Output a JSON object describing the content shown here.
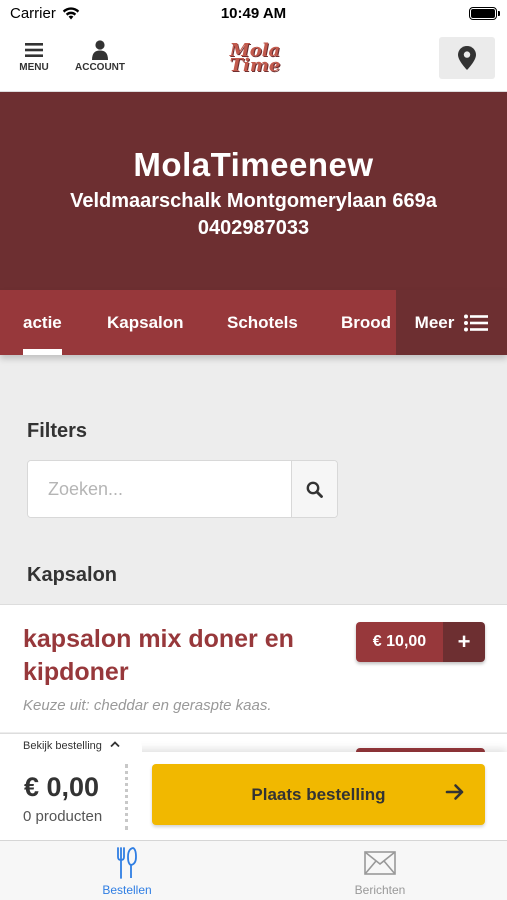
{
  "status_bar": {
    "carrier": "Carrier",
    "time": "10:49 AM"
  },
  "nav": {
    "menu_label": "MENU",
    "account_label": "ACCOUNT",
    "logo_line1": "Mola",
    "logo_line2": "Time"
  },
  "restaurant": {
    "name": "MolaTimeenew",
    "address": "Veldmaarschalk Montgomerylaan 669a",
    "phone": "0402987033"
  },
  "categories": {
    "items": [
      "actie",
      "Kapsalon",
      "Schotels",
      "Brood"
    ],
    "more_label": "Meer",
    "active_index": 0
  },
  "filters": {
    "title": "Filters",
    "search_placeholder": "Zoeken..."
  },
  "section": {
    "title": "Kapsalon"
  },
  "products": [
    {
      "name": "kapsalon mix doner en kipdoner",
      "description": "Keuze uit: cheddar en geraspte kaas.",
      "price": "€ 10,00",
      "add_label": "+"
    }
  ],
  "order": {
    "view_label": "Bekijk bestelling",
    "total": "€ 0,00",
    "count": "0 producten",
    "place_label": "Plaats bestelling"
  },
  "tabbar": {
    "orders_label": "Bestellen",
    "messages_label": "Berichten"
  },
  "colors": {
    "brand": "#6d2f31",
    "brand_light": "#97383b",
    "accent": "#f1b800",
    "active_tab": "#2f7ee3"
  }
}
